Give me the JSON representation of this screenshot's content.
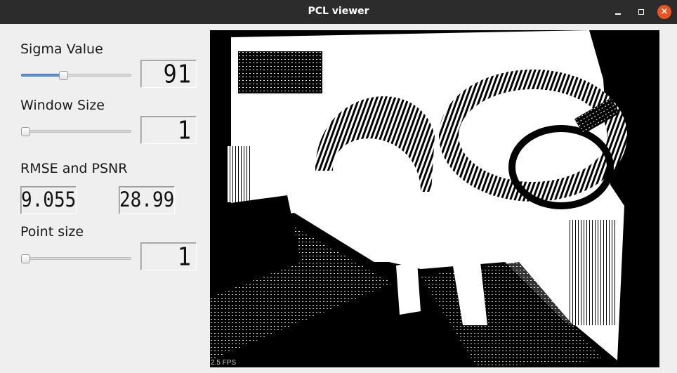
{
  "window": {
    "title": "PCL viewer",
    "buttons": {
      "minimize": "min-icon",
      "maximize": "max-icon",
      "close": "×"
    }
  },
  "controls": {
    "sigma": {
      "label": "Sigma Value",
      "lcd": "91",
      "slider_fraction": 0.38
    },
    "window_size": {
      "label": "Window Size",
      "lcd": "1",
      "slider_fraction": 0.0
    },
    "rmse_psnr": {
      "label": "RMSE and PSNR",
      "rmse": "9.055",
      "psnr": "28.99"
    },
    "point_size": {
      "label": "Point size",
      "lcd": "1",
      "slider_fraction": 0.0
    }
  },
  "viewer": {
    "fps": "2.5 FPS"
  },
  "colors": {
    "titlebar": "#2c2c2c",
    "close_button": "#e95420",
    "slider_fill": "#5c8fd6",
    "panel": "#efefef"
  }
}
